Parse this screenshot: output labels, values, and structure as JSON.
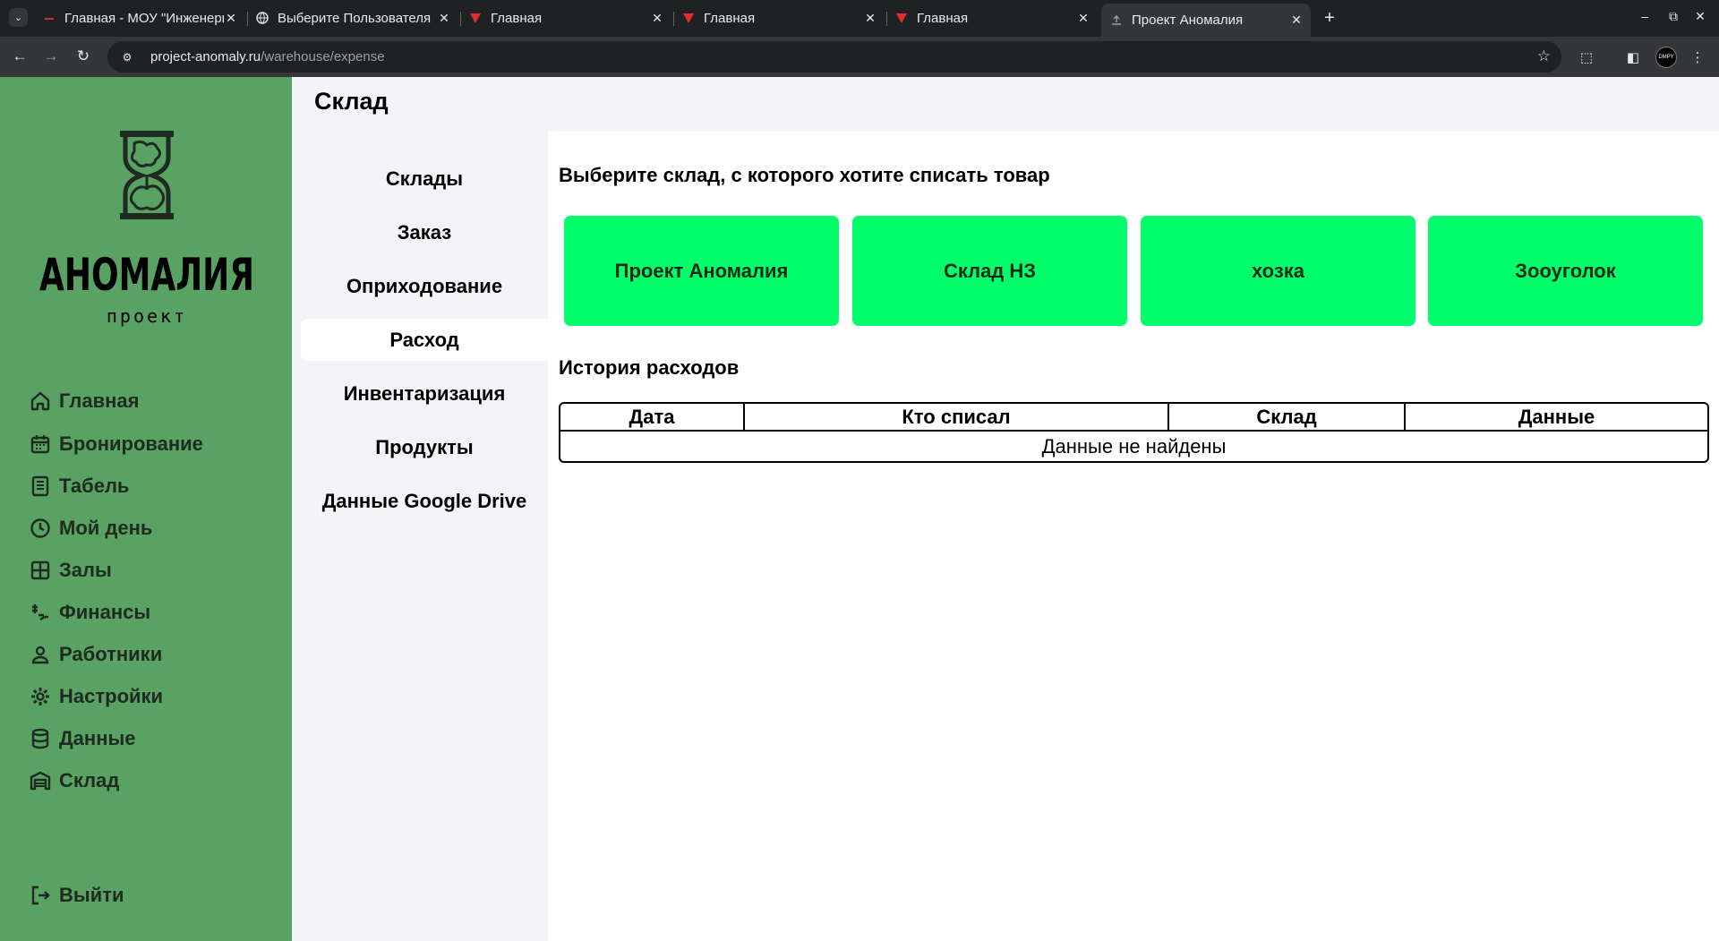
{
  "browser": {
    "tabs": [
      {
        "title": "Главная - МОУ \"Инженерная",
        "active": false
      },
      {
        "title": "Выберите Пользователя",
        "active": false
      },
      {
        "title": "Главная",
        "active": false
      },
      {
        "title": "Главная",
        "active": false
      },
      {
        "title": "Главная",
        "active": false
      },
      {
        "title": "Проект Аномалия",
        "active": true
      }
    ],
    "url_host": "project-anomaly.ru",
    "url_path": "/warehouse/expense",
    "avatar_label": "DMPY"
  },
  "brand": {
    "logo_word": "АНОМАЛИЯ",
    "logo_sub": "проект",
    "accent_color": "#5aa164",
    "button_color": "#00ff6a"
  },
  "sidebar": {
    "items": [
      {
        "label": "Главная",
        "icon": "home-icon"
      },
      {
        "label": "Бронирование",
        "icon": "calendar-icon"
      },
      {
        "label": "Табель",
        "icon": "document-icon"
      },
      {
        "label": "Мой день",
        "icon": "clock-icon"
      },
      {
        "label": "Залы",
        "icon": "grid-icon"
      },
      {
        "label": "Финансы",
        "icon": "money-icon"
      },
      {
        "label": "Работники",
        "icon": "user-icon"
      },
      {
        "label": "Настройки",
        "icon": "gear-icon"
      },
      {
        "label": "Данные",
        "icon": "database-icon"
      },
      {
        "label": "Склад",
        "icon": "warehouse-icon"
      }
    ],
    "logout_label": "Выйти"
  },
  "page": {
    "title": "Склад"
  },
  "subnav": {
    "items": [
      {
        "label": "Склады",
        "active": false
      },
      {
        "label": "Заказ",
        "active": false
      },
      {
        "label": "Оприходование",
        "active": false
      },
      {
        "label": "Расход",
        "active": true
      },
      {
        "label": "Инвентаризация",
        "active": false
      },
      {
        "label": "Продукты",
        "active": false
      },
      {
        "label": "Данные Google Drive",
        "active": false
      }
    ]
  },
  "main": {
    "select_title": "Выберите склад, с которого хотите списать товар",
    "warehouses": [
      "Проект Аномалия",
      "Склад НЗ",
      "хозка",
      "Зооуголок"
    ],
    "history_title": "История расходов",
    "table": {
      "headers": [
        "Дата",
        "Кто списал",
        "Склад",
        "Данные"
      ],
      "empty_message": "Данные не найдены"
    }
  }
}
